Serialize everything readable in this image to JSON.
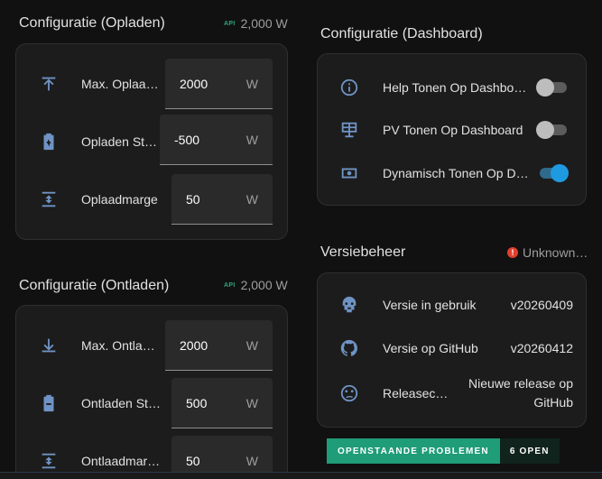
{
  "charge": {
    "title": "Configuratie (Opladen)",
    "api_label": "API",
    "meta_value": "2,000 W",
    "rows": [
      {
        "icon": "arrow-collapse-up-icon",
        "label": "Max. Oplaa…",
        "value": "2000",
        "unit": "W"
      },
      {
        "icon": "battery-charging-icon",
        "label": "Opladen St…",
        "value": "-500",
        "unit": "W"
      },
      {
        "icon": "arrow-expand-vertical-icon",
        "label": "Oplaadmarge",
        "value": "50",
        "unit": "W"
      }
    ]
  },
  "discharge": {
    "title": "Configuratie (Ontladen)",
    "api_label": "API",
    "meta_value": "2,000 W",
    "rows": [
      {
        "icon": "arrow-collapse-down-icon",
        "label": "Max. Ontla…",
        "value": "2000",
        "unit": "W"
      },
      {
        "icon": "battery-minus-icon",
        "label": "Ontladen St…",
        "value": "500",
        "unit": "W"
      },
      {
        "icon": "arrow-expand-vertical-icon",
        "label": "Ontlaadmar…",
        "value": "50",
        "unit": "W"
      }
    ]
  },
  "dashboard": {
    "title": "Configuratie (Dashboard)",
    "rows": [
      {
        "icon": "information-outline-icon",
        "label": "Help Tonen Op Dashbo…",
        "state": "off"
      },
      {
        "icon": "solar-panel-icon",
        "label": "PV Tonen Op Dashboard",
        "state": "off"
      },
      {
        "icon": "cash-icon",
        "label": "Dynamisch Tonen Op D…",
        "state": "on"
      }
    ]
  },
  "version": {
    "title": "Versiebeheer",
    "status_icon": "!",
    "status": "Unknown…",
    "rows": [
      {
        "icon": "robot-icon",
        "label": "Versie in gebruik",
        "value": "v20260409"
      },
      {
        "icon": "github-icon",
        "label": "Versie op GitHub",
        "value": "v20260412"
      },
      {
        "icon": "emoticon-confused-icon",
        "label": "Releasec…",
        "value_line1": "Nieuwe release op",
        "value_line2": "GitHub"
      }
    ]
  },
  "issues": {
    "label": "OPENSTAANDE PROBLEMEN",
    "count": "6 OPEN"
  },
  "colors": {
    "icon": "#6f93c4",
    "accent_toggle": "#1e9ae0",
    "issue_green": "#1f9c78",
    "warning": "#e0402f"
  }
}
